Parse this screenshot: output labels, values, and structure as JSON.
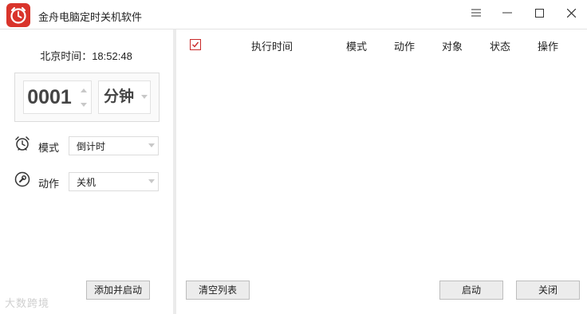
{
  "window": {
    "title": "金舟电脑定时关机软件",
    "brand_color": "#d9342b",
    "logo_icon": "alarm-clock-logo"
  },
  "left_panel": {
    "clock_label": "北京时间：",
    "clock_time": "18:52:48",
    "timer": {
      "value": "0001",
      "unit": "分钟"
    },
    "mode": {
      "label": "模式",
      "icon": "alarm-clock-icon",
      "selected": "倒计时"
    },
    "action": {
      "label": "动作",
      "icon": "wrench-icon",
      "selected": "关机"
    },
    "add_button": "添加并启动"
  },
  "right_panel": {
    "header_checked": true,
    "columns": [
      "执行时间",
      "模式",
      "动作",
      "对象",
      "状态",
      "操作"
    ],
    "rows": [],
    "clear_button": "清空列表",
    "start_button": "启动",
    "close_button": "关闭"
  },
  "watermark": "大数跨境"
}
